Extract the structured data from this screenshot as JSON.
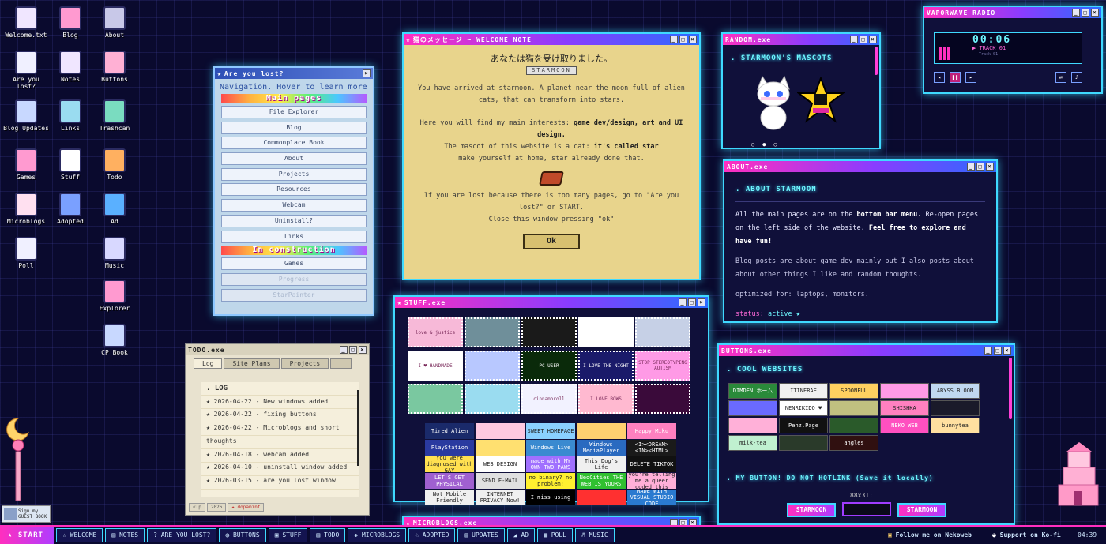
{
  "desktop_icons": [
    {
      "label": "Welcome.txt",
      "icon": "text-file-icon"
    },
    {
      "label": "Blog",
      "icon": "book-icon"
    },
    {
      "label": "About",
      "icon": "computer-icon"
    },
    {
      "label": "Are you lost?",
      "icon": "magnifier-icon"
    },
    {
      "label": "Notes",
      "icon": "notes-icon"
    },
    {
      "label": "Buttons",
      "icon": "document-icon"
    },
    {
      "label": "Blog Updates",
      "icon": "window-icon"
    },
    {
      "label": "Links",
      "icon": "links-icon"
    },
    {
      "label": "Trashcan",
      "icon": "trashcan-icon"
    },
    {
      "label": "Games",
      "icon": "games-icon"
    },
    {
      "label": "Stuff",
      "icon": "font-icon"
    },
    {
      "label": "Todo",
      "icon": "megaphone-icon"
    },
    {
      "label": "Microblogs",
      "icon": "calendar-icon"
    },
    {
      "label": "Adopted",
      "icon": "ribbon-icon"
    },
    {
      "label": "Ad",
      "icon": "globe-icon"
    },
    {
      "label": "Poll",
      "icon": "poll-icon"
    },
    {
      "label": "Music",
      "icon": "cd-icon"
    },
    {
      "label": "Explorer",
      "icon": "folder-icon"
    },
    {
      "label": "CP Book",
      "icon": "cp-book-icon"
    }
  ],
  "lost": {
    "title": "Are you lost?",
    "intro": "Navigation. Hover to learn more",
    "section_main": "Main pages",
    "main_items": [
      "File Explorer",
      "Blog",
      "Commonplace Book",
      "About",
      "Projects",
      "Resources",
      "Webcam",
      "Uninstall?",
      "Links"
    ],
    "section_wip": "In construction",
    "wip_items": [
      "Games",
      "Progress",
      "StarPainter"
    ]
  },
  "welcome": {
    "title": "猫のメッセージ ~ WELCOME NOTE",
    "heading": "あなたは猫を受け取りました。",
    "badge": "STARMOON",
    "p1": "You have arrived at starmoon. A planet near the moon full of alien cats, that can transform into stars.",
    "p2_pre": "Here you will find my main interests: ",
    "p2_bold": "game dev/design, art and UI design.",
    "p3_pre": "The mascot of this website is a cat: ",
    "p3_bold": "it's called star",
    "p4": "make yourself at home, star already done that.",
    "p5": "If you are lost because there is too many pages, go to \"Are you lost?\" or START.",
    "p6": "Close this window pressing \"ok\"",
    "ok": "Ok"
  },
  "random": {
    "title": "RANDOM.exe",
    "heading": ". STARMOON'S MASCOTS"
  },
  "about": {
    "title": "ABOUT.exe",
    "heading": ". ABOUT STARMOON",
    "p1_pre": "All the main pages are on the ",
    "p1_bold1": "bottom bar menu.",
    "p1_mid": " Re-open pages on the left side of the website. ",
    "p1_bold2": "Feel free to explore and have fun!",
    "p2": "Blog posts are about game dev mainly but I also posts about about other things I like and random thoughts.",
    "p3": "optimized for: laptops, monitors.",
    "status_label": "status:",
    "status_value": "active ★"
  },
  "radio": {
    "title": "VAPORWAVE RADIO",
    "time": "00:06",
    "track": "TRACK 01",
    "subtitle": "Track 01"
  },
  "stuff": {
    "title": "STUFF.exe",
    "stamps": [
      {
        "label": "love & justice",
        "bg": "#f7b9d8"
      },
      {
        "label": "",
        "bg": "#6f8f9a"
      },
      {
        "label": "",
        "bg": "#1a1a1a"
      },
      {
        "label": "",
        "bg": "#ffffff"
      },
      {
        "label": "",
        "bg": "#c6d0e6"
      },
      {
        "label": "I ♥ HANDMADE",
        "bg": "#ffffff"
      },
      {
        "label": "",
        "bg": "#b8c8ff"
      },
      {
        "label": "PC USER",
        "bg": "#0a2a0a"
      },
      {
        "label": "I LOVE THE NIGHT",
        "bg": "#1a1a6a"
      },
      {
        "label": "STOP STEREOTYPING AUTISM",
        "bg": "#ff9ae6"
      },
      {
        "label": "",
        "bg": "#7ac8a0"
      },
      {
        "label": "",
        "bg": "#9adcf0"
      },
      {
        "label": "cinnamoroll",
        "bg": "#f2f2ff"
      },
      {
        "label": "I LOVE BOWS",
        "bg": "#ffb9d0"
      },
      {
        "label": "",
        "bg": "#3a0a3a"
      }
    ],
    "buttons": [
      {
        "label": "Tired Alien",
        "bg": "#1a2a6a"
      },
      {
        "label": "",
        "bg": "#ffc8e0"
      },
      {
        "label": "SWEET HOMEPAGE",
        "bg": "#8ad0ff"
      },
      {
        "label": "",
        "bg": "#ffd070"
      },
      {
        "label": "Happy Miku",
        "bg": "#ff80c0"
      },
      {
        "label": "PlayStation",
        "bg": "#2a3aa0"
      },
      {
        "label": "",
        "bg": "#ffe070"
      },
      {
        "label": "Windows Live",
        "bg": "#3a8ad0"
      },
      {
        "label": "Windows MediaPlayer",
        "bg": "#2a6ac0"
      },
      {
        "label": "<I><DREAM> <IN><HTML>",
        "bg": "#1a1a1a"
      },
      {
        "label": "You were diagnosed with GAY",
        "bg": "#ffe050"
      },
      {
        "label": "WEB DESIGN",
        "bg": "#ffffff"
      },
      {
        "label": "made with MY OWN TWO PAWS",
        "bg": "#a070ff"
      },
      {
        "label": "This Dog's Life",
        "bg": "#f0f0f0"
      },
      {
        "label": "DELETE TIKTOK",
        "bg": "#111111"
      },
      {
        "label": "LET'S GET PHYSICAL",
        "bg": "#a060d0"
      },
      {
        "label": "SEND E-MAIL",
        "bg": "#e0e0e0"
      },
      {
        "label": "no binary? no problem!",
        "bg": "#fff030"
      },
      {
        "label": "NeoCities THE WEB IS YOURS",
        "bg": "#30c030"
      },
      {
        "label": "you're telling me a queer coded this",
        "bg": "#ffb0d8"
      },
      {
        "label": "Not Mobile Friendly",
        "bg": "#f0f0f0"
      },
      {
        "label": "INTERNET PRIVACY Now!",
        "bg": "#f0f0f0"
      },
      {
        "label": "I miss using",
        "bg": "#000000"
      },
      {
        "label": "",
        "bg": "#ff3030"
      },
      {
        "label": "MADE WITH VISUAL STUDIO CODE",
        "bg": "#2a7ad0"
      }
    ]
  },
  "todo": {
    "title": "TODO.exe",
    "tabs": [
      "Log",
      "Site Plans",
      "Projects"
    ],
    "heading": ". LOG",
    "entries": [
      "★ 2026-04-22 - New windows added",
      "★ 2026-04-22 - fixing buttons",
      "★ 2026-04-22 - Microblogs and short thoughts",
      "★ 2026-04-18 - webcam added",
      "★ 2026-04-10 - uninstall window added",
      "★ 2026-03-15 - are you lost window"
    ],
    "status_cells": [
      "<lp",
      "2026",
      "★ dopamint"
    ]
  },
  "buttons_win": {
    "title": "BUTTONS.exe",
    "heading": ". COOL WEBSITES",
    "sites": [
      {
        "label": "DIMDEN ホーム",
        "bg": "#2a8a3a"
      },
      {
        "label": "ITINERAE",
        "bg": "#f0f0f0"
      },
      {
        "label": "SPOONFUL",
        "bg": "#ffd060"
      },
      {
        "label": "",
        "bg": "#ff9ae6"
      },
      {
        "label": "ABYSS BLOOM",
        "bg": "#c0d8f0"
      },
      {
        "label": "",
        "bg": "#6a6aff"
      },
      {
        "label": "NENRIKIDO ♥",
        "bg": "#ffffff"
      },
      {
        "label": "",
        "bg": "#c0c080"
      },
      {
        "label": "SHISHKA",
        "bg": "#ff80c0"
      },
      {
        "label": "",
        "bg": "#1a1a2a"
      },
      {
        "label": "",
        "bg": "#ffb0d8"
      },
      {
        "label": "Penz.Page",
        "bg": "#111111"
      },
      {
        "label": "",
        "bg": "#2a5a2a"
      },
      {
        "label": "NEKO WEB",
        "bg": "#ff50c0"
      },
      {
        "label": "bunnytea",
        "bg": "#ffe0a0"
      },
      {
        "label": "milk-tea",
        "bg": "#c0f0d0"
      },
      {
        "label": "",
        "bg": "#2a3a2a"
      },
      {
        "label": "angles",
        "bg": "#301010"
      }
    ],
    "heading2": ". MY BUTTON! DO NOT HOTLINK (Save it locally)",
    "size_label": "88x31:",
    "my_buttons": [
      "STARMOON",
      "",
      "STARMOON"
    ]
  },
  "micro": {
    "title": "MICROBLOGS.exe"
  },
  "taskbar": {
    "start": "★ START",
    "items": [
      {
        "label": "☆ WELCOME"
      },
      {
        "label": "▤ NOTES"
      },
      {
        "label": "? ARE YOU LOST?"
      },
      {
        "label": "◍ BUTTONS"
      },
      {
        "label": "▣ STUFF"
      },
      {
        "label": "▤ TODO"
      },
      {
        "label": "✚ MICROBLOGS"
      },
      {
        "label": "♘ ADOPTED"
      },
      {
        "label": "▤ UPDATES"
      },
      {
        "label": "◢ AD"
      },
      {
        "label": "▦ POLL"
      },
      {
        "label": "♬ MUSIC"
      }
    ],
    "follow": "Follow me on Nekoweb",
    "support": "Support on Ko-fi",
    "clock": "04:39"
  },
  "guestbook": {
    "label": "Sign my GUEST BOOK"
  },
  "colors": {
    "neon_cyan": "#3fd9ff",
    "neon_pink": "#ff2fbf",
    "bg": "#0a0a2e"
  }
}
